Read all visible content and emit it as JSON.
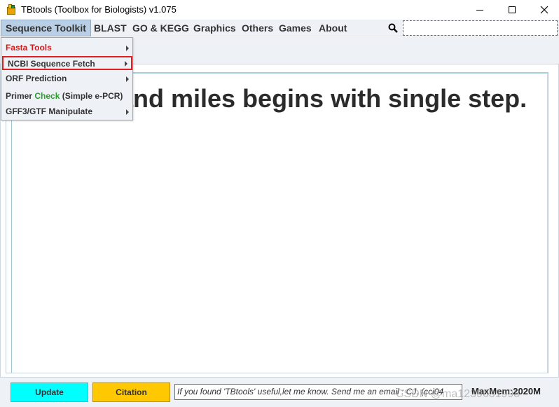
{
  "window": {
    "title": "TBtools (Toolbox for Biologists) v1.075"
  },
  "menubar": {
    "items": [
      {
        "label": "Sequence Toolkit",
        "active": true
      },
      {
        "label": "BLAST"
      },
      {
        "label": "GO & KEGG"
      },
      {
        "label": "Graphics"
      },
      {
        "label": "Others"
      },
      {
        "label": "Games"
      },
      {
        "label": "About"
      }
    ],
    "search_value": ""
  },
  "dropdown": {
    "items": [
      {
        "label": "Fasta Tools",
        "has_submenu": true
      },
      {
        "label": "NCBI Sequence Fetch",
        "has_submenu": true,
        "highlighted": true
      },
      {
        "label": "ORF Prediction",
        "has_submenu": true
      },
      {
        "label_prefix": "Primer ",
        "label_check": "Check",
        "label_suffix": " (Simple e-PCR)",
        "has_submenu": false
      },
      {
        "label": "GFF3/GTF Manipulate",
        "has_submenu": true
      }
    ]
  },
  "main": {
    "quote_visible": "f a thousand miles begins with single step."
  },
  "bottom": {
    "update_label": "Update",
    "citation_label": "Citation",
    "message": "If you found 'TBtools' useful,let me know. Send me an email : CJ. (cci04",
    "maxmem": "MaxMem:2020M",
    "watermark": "CSDN @ma1239631998"
  },
  "colors": {
    "menu_bg": "#eef2f7",
    "active_menu": "#b8cfe5",
    "fasta_red": "#d11a1a",
    "check_green": "#2e9c2e",
    "update_cyan": "#00ffff",
    "citation_gold": "#ffc800",
    "highlight_border": "#e02020"
  }
}
